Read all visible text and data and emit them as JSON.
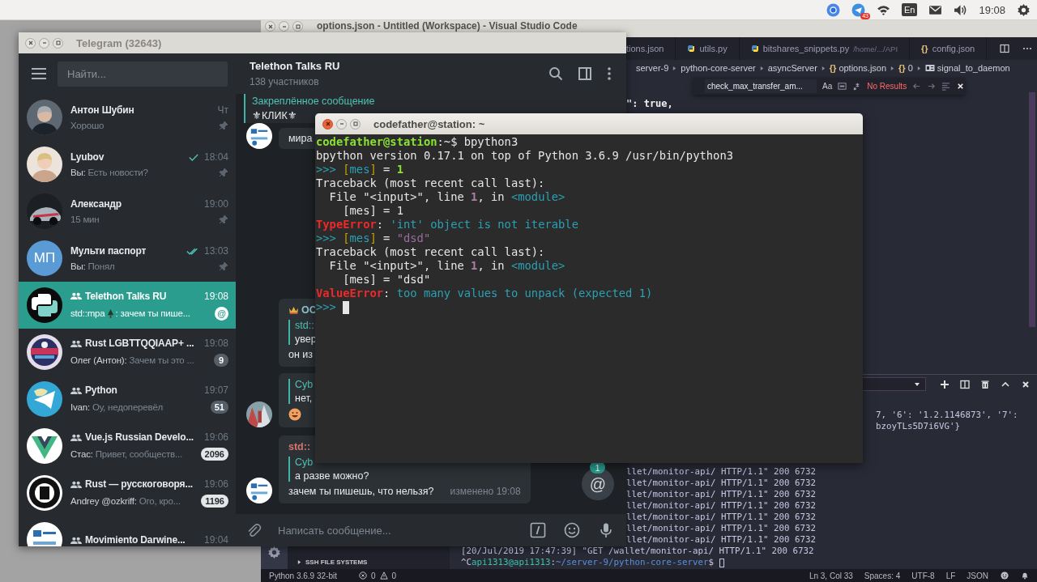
{
  "top_bar": {
    "app_badge": "43",
    "keyboard_layout": "En",
    "clock": "19:08"
  },
  "vscode": {
    "title": "options.json - Untitled (Workspace) - Visual Studio Code",
    "tabs": [
      {
        "label": "tions.json",
        "python": false
      },
      {
        "label": "utils.py",
        "python": true
      },
      {
        "label": "bitshares_snippets.py",
        "path": "/home/.../API",
        "python": true
      },
      {
        "label": "config.json",
        "glyph": "{}",
        "python": false
      }
    ],
    "breadcrumbs": [
      {
        "label": "server-9",
        "kind": "text"
      },
      {
        "label": "python-core-server",
        "kind": "text"
      },
      {
        "label": "asyncServer",
        "kind": "text"
      },
      {
        "label": "options.json",
        "glyph": "{}",
        "kind": "braces"
      },
      {
        "label": "0",
        "glyph": "{}",
        "kind": "braces"
      },
      {
        "label": "signal_to_daemon",
        "kind": "property"
      }
    ],
    "find": {
      "query": "check_max_transfer_am...",
      "match_case": "Aa",
      "result": "No Results"
    },
    "code_line": "\": true,",
    "sidebar_section": "SSH FILE SYSTEMS",
    "panel_lines": [
      {
        "kind": "tail",
        "segs": [
          {
            "text": "7, '6': '1.2.1146873', '7':",
            "kind": "plain"
          }
        ]
      },
      {
        "kind": "tail",
        "segs": [
          {
            "text": "bzoyTLs5D7i6VG'}",
            "kind": "plain"
          }
        ]
      },
      {
        "kind": "fragment",
        "segs": [
          {
            "text": "llet/monitor-api/ HTTP/1.1\" 200 6732",
            "kind": "plain"
          }
        ]
      },
      {
        "kind": "fragment",
        "segs": [
          {
            "text": "llet/monitor-api/ HTTP/1.1\" 200 6732",
            "kind": "plain"
          }
        ]
      },
      {
        "kind": "fragment",
        "segs": [
          {
            "text": "llet/monitor-api/ HTTP/1.1\" 200 6732",
            "kind": "plain"
          }
        ]
      },
      {
        "kind": "fragment",
        "segs": [
          {
            "text": "llet/monitor-api/ HTTP/1.1\" 200 6732",
            "kind": "plain"
          }
        ]
      },
      {
        "kind": "fragment",
        "segs": [
          {
            "text": "llet/monitor-api/ HTTP/1.1\" 200 6732",
            "kind": "plain"
          }
        ]
      },
      {
        "kind": "fragment",
        "segs": [
          {
            "text": "llet/monitor-api/ HTTP/1.1\" 200 6732",
            "kind": "plain"
          }
        ]
      },
      {
        "kind": "fragment",
        "segs": [
          {
            "text": "llet/monitor-api/ HTTP/1.1\" 200 6732",
            "kind": "plain"
          }
        ]
      },
      {
        "kind": "full",
        "segs": [
          {
            "text": "[20/Jul/2019 17:47:39] \"GET /wallet/monitor-api/ HTTP/1.1\" 200 6732",
            "kind": "plain"
          }
        ]
      },
      {
        "kind": "full",
        "cursor": true,
        "segs": [
          {
            "text": "^C",
            "kind": "plain"
          },
          {
            "text": "api1313@api1313",
            "kind": "host"
          },
          {
            "text": ":",
            "kind": "plain"
          },
          {
            "text": "~/server-9/python-core-server",
            "kind": "path"
          },
          {
            "text": "$ ",
            "kind": "plain"
          }
        ]
      }
    ],
    "status_bar": {
      "interpreter": "Python 3.6.9 32-bit",
      "errors": "0",
      "warnings": "0",
      "right": [
        "Ln 3, Col 33",
        "Spaces: 4",
        "UTF-8",
        "LF",
        "JSON"
      ]
    }
  },
  "telegram": {
    "title": "Telegram (32643)",
    "search_placeholder": "Найти...",
    "chats": [
      {
        "name": "Антон Шубин",
        "time": "Чт",
        "preview": "Хорошо",
        "group": false,
        "pinned": true,
        "selected": false
      },
      {
        "name": "Lyubov",
        "time": "18:04",
        "sender": "Вы:",
        "preview": "Есть новости?",
        "read": false,
        "group": false,
        "pinned": true,
        "selected": false
      },
      {
        "name": "Александр",
        "time": "19:00",
        "preview": "15 мин",
        "group": false,
        "pinned": true,
        "selected": false
      },
      {
        "name": "Мульти паспорт",
        "time": "13:03",
        "sender": "Вы:",
        "preview": "Понял",
        "read": true,
        "group": false,
        "pinned": true,
        "selected": false,
        "avatar": {
          "kind": "initials",
          "text": "МП",
          "color": "#5b9bd5"
        }
      },
      {
        "name": "Telethon Talks RU",
        "time": "19:08",
        "sender": "std::mpa",
        "sender_emoji": true,
        "preview": ": зачем ты пише...",
        "mention": "@",
        "group": true,
        "pinned": false,
        "selected": true
      },
      {
        "name": "Rust LGBTTQQIAAP+ ...",
        "time": "19:08",
        "sender": "Олег (Антон):",
        "preview": "Зачем ты это ...",
        "badge": "9",
        "muted": true,
        "group": true,
        "pinned": false,
        "selected": false
      },
      {
        "name": "Python",
        "time": "19:07",
        "sender": "Ivan:",
        "preview": "Оу, недоперевёл",
        "badge": "51",
        "muted": true,
        "group": true,
        "pinned": false,
        "selected": false
      },
      {
        "name": "Vue.js Russian Develo...",
        "time": "19:06",
        "sender": "Стас:",
        "preview": "Привет, сообществ...",
        "badge": "2096",
        "muted": false,
        "group": true,
        "pinned": false,
        "selected": false
      },
      {
        "name": "Rust — русскоговоря...",
        "time": "19:06",
        "sender": "Andrey @ozkriff:",
        "preview": "Ого, кро...",
        "badge": "1196",
        "muted": false,
        "group": true,
        "pinned": false,
        "selected": false
      },
      {
        "name": "Movimiento Darwine...",
        "time": "19:04",
        "group": true,
        "pinned": false,
        "selected": false
      }
    ],
    "chat": {
      "title": "Telethon Talks RU",
      "subtitle": "138 участников",
      "pinned": {
        "label": "Закреплённое сообщение",
        "text": "⚜КЛИК⚜"
      },
      "messages": [
        {
          "text": "мира",
          "avatar": true
        },
        {
          "header": "ОС",
          "color": "#8fc3cf",
          "crowned": true,
          "reply": {
            "sender": "std::",
            "text": "увер"
          },
          "text": "он из",
          "avatar": false
        },
        {
          "reply": {
            "sender": "Cyb",
            "text": "нет,"
          },
          "smiley": true,
          "avatar": true
        },
        {
          "header": "std::",
          "color": "#d9736e",
          "crowned": false,
          "reply": {
            "sender": "Cyb",
            "text": "а разве можно?"
          },
          "text": "зачем ты пишешь, что нельзя?",
          "meta": "изменено 19:08",
          "avatar": true
        }
      ],
      "input_placeholder": "Написать сообщение...",
      "mention_button": {
        "symbol": "@",
        "count": "1"
      }
    }
  },
  "terminal": {
    "title": "codefather@station: ~",
    "lines": [
      {
        "segs": [
          {
            "text": "codefather@station",
            "kind": "user"
          },
          {
            "text": ":~$ bpython3",
            "kind": "plain"
          }
        ]
      },
      {
        "segs": [
          {
            "text": "bpython version 0.17.1 on top of Python 3.6.9 /usr/bin/python3",
            "kind": "plain"
          }
        ]
      },
      {
        "segs": [
          {
            "text": ">>> ",
            "kind": "prompt"
          },
          {
            "text": "[",
            "kind": "bracket"
          },
          {
            "text": "mes",
            "kind": "name"
          },
          {
            "text": "]",
            "kind": "bracket"
          },
          {
            "text": " = ",
            "kind": "plain"
          },
          {
            "text": "1",
            "kind": "number"
          }
        ]
      },
      {
        "segs": [
          {
            "text": "Traceback (most recent call last):",
            "kind": "plain"
          }
        ]
      },
      {
        "segs": [
          {
            "text": "  File \"<input>\", line ",
            "kind": "plain"
          },
          {
            "text": "1",
            "kind": "lineno"
          },
          {
            "text": ", in ",
            "kind": "plain"
          },
          {
            "text": "<module>",
            "kind": "name"
          }
        ]
      },
      {
        "segs": [
          {
            "text": "    [mes] = 1",
            "kind": "plain"
          }
        ]
      },
      {
        "segs": [
          {
            "text": "TypeError",
            "kind": "error"
          },
          {
            "text": ": ",
            "kind": "plain"
          },
          {
            "text": "'int' object is not iterable",
            "kind": "name"
          }
        ]
      },
      {
        "segs": [
          {
            "text": ">>> ",
            "kind": "prompt"
          },
          {
            "text": "[",
            "kind": "bracket"
          },
          {
            "text": "mes",
            "kind": "name"
          },
          {
            "text": "]",
            "kind": "bracket"
          },
          {
            "text": " = ",
            "kind": "plain"
          },
          {
            "text": "\"dsd\"",
            "kind": "string"
          }
        ]
      },
      {
        "segs": [
          {
            "text": "Traceback (most recent call last):",
            "kind": "plain"
          }
        ]
      },
      {
        "segs": [
          {
            "text": "  File \"<input>\", line ",
            "kind": "plain"
          },
          {
            "text": "1",
            "kind": "lineno"
          },
          {
            "text": ", in ",
            "kind": "plain"
          },
          {
            "text": "<module>",
            "kind": "name"
          }
        ]
      },
      {
        "segs": [
          {
            "text": "    [mes] = \"dsd\"",
            "kind": "plain"
          }
        ]
      },
      {
        "segs": [
          {
            "text": "ValueError",
            "kind": "error"
          },
          {
            "text": ": ",
            "kind": "plain"
          },
          {
            "text": "too many values to unpack (expected 1)",
            "kind": "name"
          }
        ]
      },
      {
        "cursor": true,
        "segs": [
          {
            "text": ">>> ",
            "kind": "prompt"
          }
        ]
      }
    ]
  }
}
